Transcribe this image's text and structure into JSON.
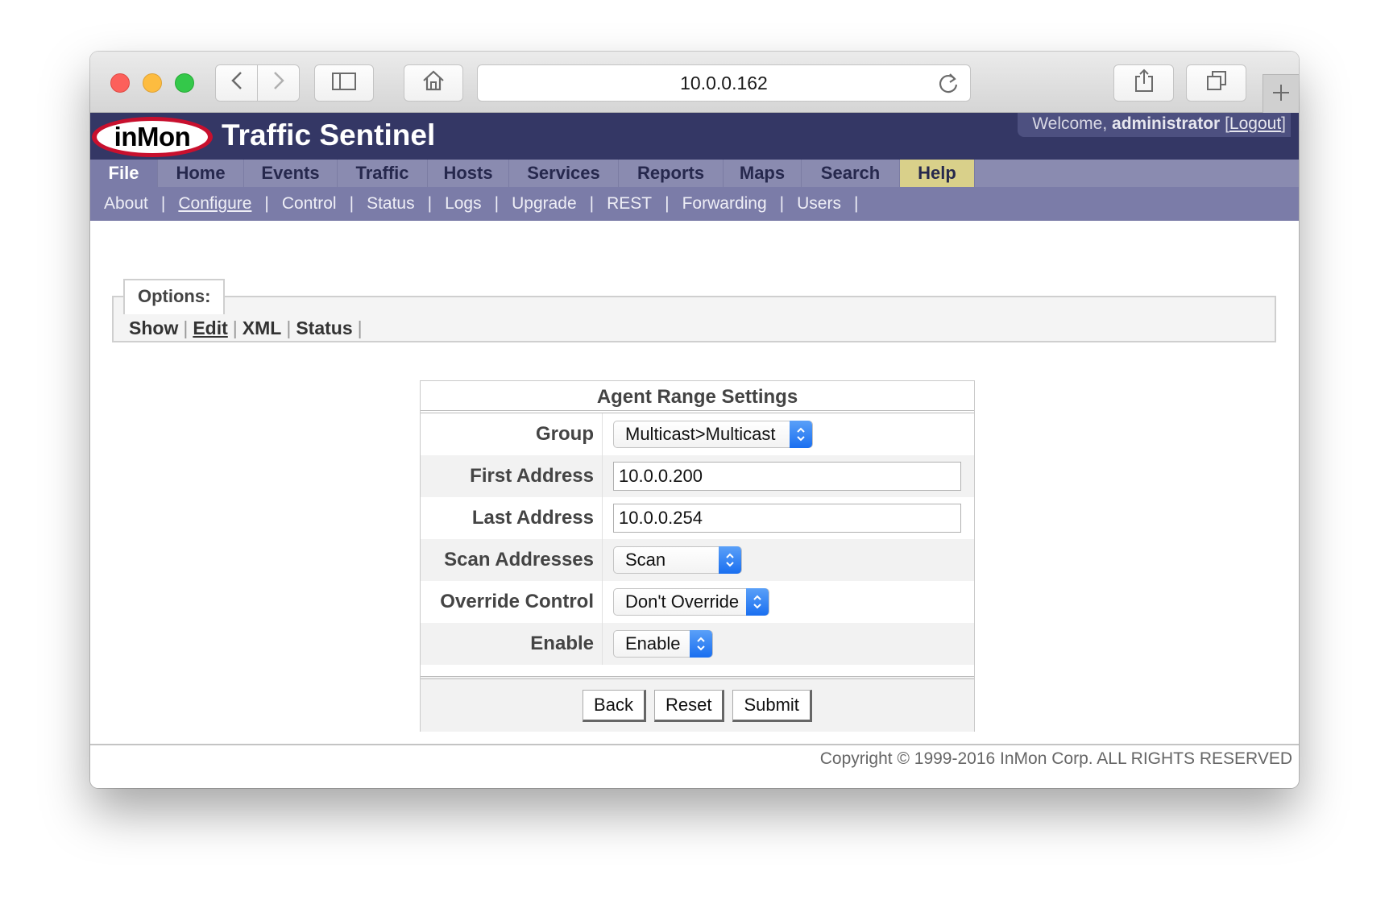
{
  "browser": {
    "url": "10.0.0.162",
    "icons": {
      "back": "chevron-left-icon",
      "forward": "chevron-right-icon",
      "sidebar": "sidebar-icon",
      "home": "home-icon",
      "reload": "reload-icon",
      "share": "share-icon",
      "tabs": "tabs-icon",
      "new_tab": "plus-icon"
    }
  },
  "header": {
    "logo_text": "inMon",
    "title": "Traffic Sentinel",
    "welcome_prefix": "Welcome, ",
    "user": "administrator",
    "logout": "Logout"
  },
  "mainnav": [
    {
      "label": "File"
    },
    {
      "label": "Home"
    },
    {
      "label": "Events"
    },
    {
      "label": "Traffic"
    },
    {
      "label": "Hosts"
    },
    {
      "label": "Services"
    },
    {
      "label": "Reports"
    },
    {
      "label": "Maps"
    },
    {
      "label": "Search"
    },
    {
      "label": "Help"
    }
  ],
  "subnav": [
    {
      "label": "About"
    },
    {
      "label": "Configure"
    },
    {
      "label": "Control"
    },
    {
      "label": "Status"
    },
    {
      "label": "Logs"
    },
    {
      "label": "Upgrade"
    },
    {
      "label": "REST"
    },
    {
      "label": "Forwarding"
    },
    {
      "label": "Users"
    }
  ],
  "options": {
    "legend": "Options:",
    "links": [
      {
        "label": "Show"
      },
      {
        "label": "Edit"
      },
      {
        "label": "XML"
      },
      {
        "label": "Status"
      }
    ]
  },
  "form": {
    "title": "Agent Range Settings",
    "group_label": "Group",
    "group_value": "Multicast>Multicast",
    "first_label": "First Address",
    "first_value": "10.0.0.200",
    "last_label": "Last Address",
    "last_value": "10.0.0.254",
    "scan_label": "Scan Addresses",
    "scan_value": "Scan",
    "override_label": "Override Control",
    "override_value": "Don't Override",
    "enable_label": "Enable",
    "enable_value": "Enable",
    "buttons": {
      "back": "Back",
      "reset": "Reset",
      "submit": "Submit"
    }
  },
  "footer": {
    "copyright": "Copyright © 1999-2016 InMon Corp. ALL RIGHTS RESERVED"
  },
  "colors": {
    "header_bg": "#343765",
    "nav_bg": "#8a8bb0",
    "subnav_bg": "#7b7ca8",
    "help_tab": "#d9d08a",
    "logo_red": "#c8102e"
  }
}
